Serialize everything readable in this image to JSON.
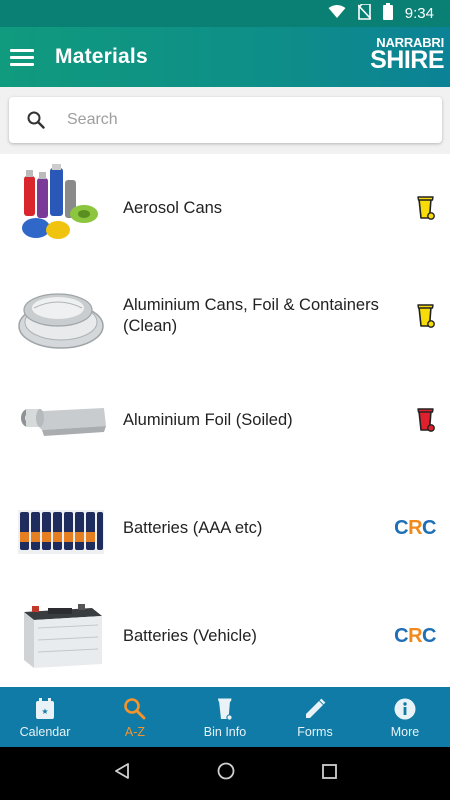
{
  "status_bar": {
    "time": "9:34"
  },
  "app_bar": {
    "title": "Materials",
    "logo_line1": "NARRABRI",
    "logo_line2": "SHIRE"
  },
  "search": {
    "placeholder": "Search"
  },
  "materials": [
    {
      "name": "Aerosol Cans",
      "bin": "yellow-bin-icon"
    },
    {
      "name": "Aluminium Cans, Foil & Containers (Clean)",
      "bin": "yellow-bin-icon"
    },
    {
      "name": "Aluminium Foil (Soiled)",
      "bin": "red-bin-icon"
    },
    {
      "name": "Batteries (AAA etc)",
      "tag": "CRC"
    },
    {
      "name": "Batteries (Vehicle)",
      "tag": "CRC"
    }
  ],
  "crc_tag": {
    "c": "C",
    "r": "R",
    "c2": "C"
  },
  "bottom_nav": [
    {
      "label": "Calendar",
      "icon": "calendar-icon"
    },
    {
      "label": "A-Z",
      "icon": "search-icon",
      "active": true
    },
    {
      "label": "Bin Info",
      "icon": "bin-icon"
    },
    {
      "label": "Forms",
      "icon": "pencil-icon"
    },
    {
      "label": "More",
      "icon": "info-icon"
    }
  ],
  "colors": {
    "app_bar": "#0e8e88",
    "bottom_nav": "#0f7ba6",
    "active_nav": "#f6932a",
    "yellow_bin": "#f7dc0a",
    "red_bin": "#e0202c",
    "crc_blue": "#1e6fb5",
    "crc_orange": "#f08a1c"
  }
}
